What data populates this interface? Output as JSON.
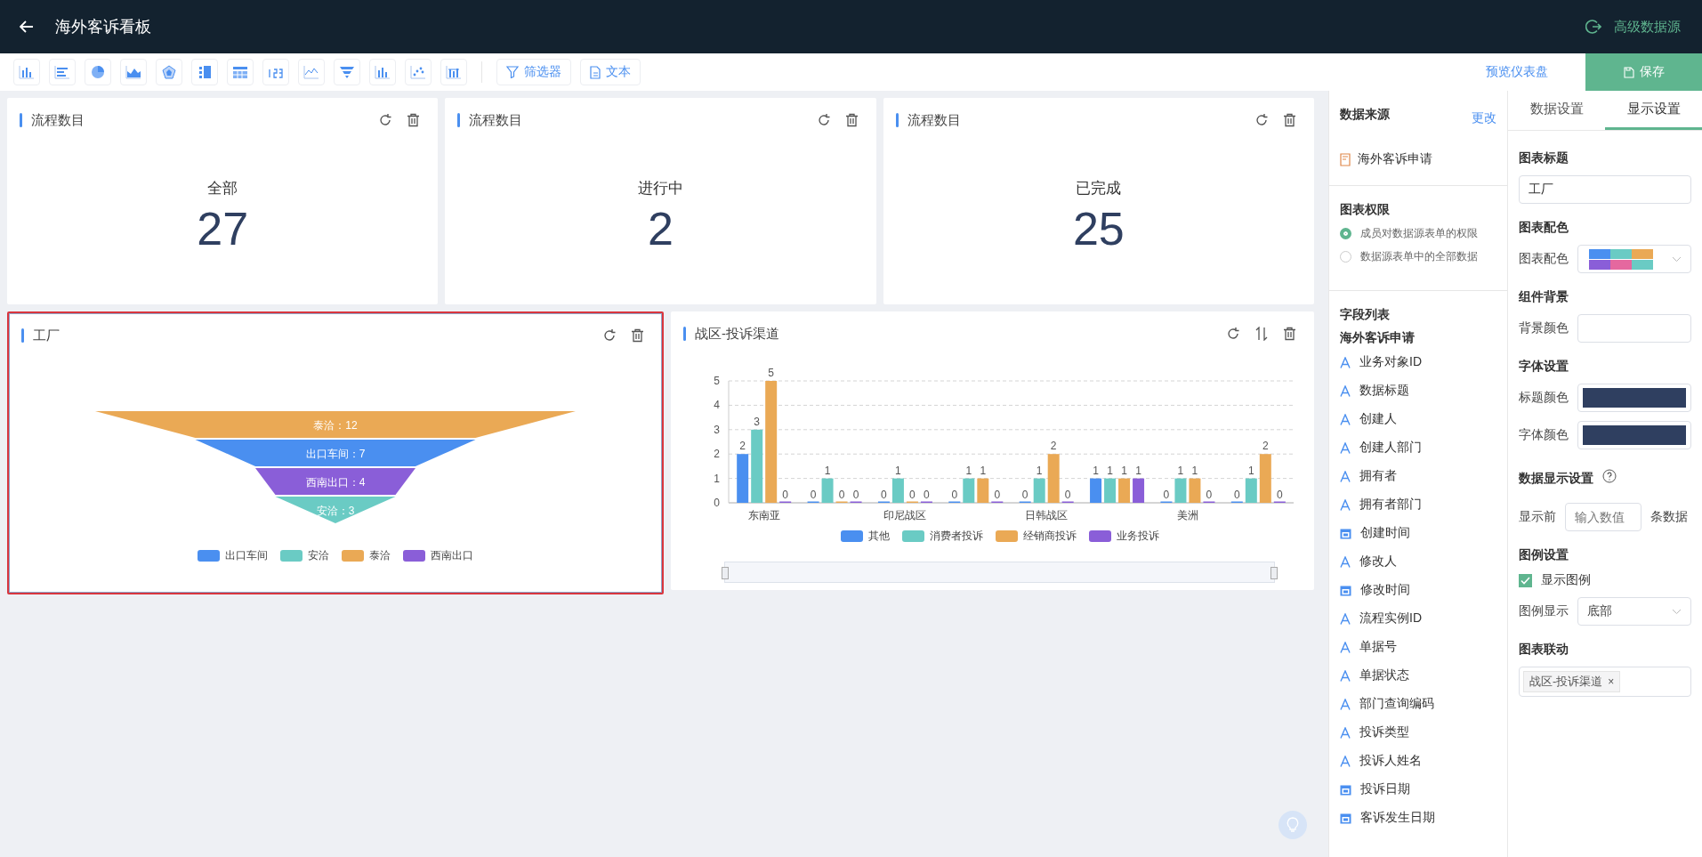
{
  "header": {
    "title": "海外客诉看板",
    "action": "高级数据源"
  },
  "toolbar": {
    "filter": "筛选器",
    "text": "文本",
    "preview": "预览仪表盘",
    "save": "保存"
  },
  "stats": [
    {
      "title": "流程数目",
      "label": "全部",
      "value": "27"
    },
    {
      "title": "流程数目",
      "label": "进行中",
      "value": "2"
    },
    {
      "title": "流程数目",
      "label": "已完成",
      "value": "25"
    }
  ],
  "funnel_card": {
    "title": "工厂",
    "selected": true,
    "separator": "：",
    "segments": [
      {
        "name": "泰洽",
        "value": "12",
        "color": "#eaa955"
      },
      {
        "name": "出口车间",
        "value": "7",
        "color": "#4a8ff0"
      },
      {
        "name": "西南出口",
        "value": "4",
        "color": "#8a5ed8"
      },
      {
        "name": "安洽",
        "value": "3",
        "color": "#6acbc4"
      }
    ],
    "legend": [
      {
        "label": "出口车间",
        "color": "#4a8ff0"
      },
      {
        "label": "安洽",
        "color": "#6acbc4"
      },
      {
        "label": "泰洽",
        "color": "#eaa955"
      },
      {
        "label": "西南出口",
        "color": "#8a5ed8"
      }
    ]
  },
  "bar_card": {
    "title": "战区-投诉渠道",
    "chart_data": {
      "type": "bar",
      "categories": [
        "东南亚",
        null,
        "印尼战区",
        null,
        "日韩战区",
        null,
        "美洲",
        null
      ],
      "ylim": [
        0,
        5
      ],
      "yticks": [
        0,
        1,
        2,
        3,
        4,
        5
      ],
      "data_labels": true,
      "grid": true,
      "legend": true,
      "series": [
        {
          "name": "其他",
          "color": "#4a8ff0",
          "values": [
            2,
            0,
            0,
            0,
            0,
            1,
            0,
            0
          ]
        },
        {
          "name": "消费者投诉",
          "color": "#6acbc4",
          "values": [
            3,
            1,
            1,
            1,
            1,
            1,
            1,
            1
          ]
        },
        {
          "name": "经销商投诉",
          "color": "#eaa955",
          "values": [
            5,
            0,
            0,
            1,
            2,
            1,
            1,
            2
          ]
        },
        {
          "name": "业务投诉",
          "color": "#8a5ed8",
          "values": [
            0,
            0,
            0,
            0,
            0,
            1,
            0,
            0
          ]
        }
      ]
    },
    "range_slider": {
      "level": 1
    }
  },
  "data_panel": {
    "source_heading": "数据来源",
    "change": "更改",
    "source": "海外客诉申请",
    "permission_heading": "图表权限",
    "permissions": [
      {
        "label": "成员对数据源表单的权限",
        "selected": true
      },
      {
        "label": "数据源表单中的全部数据",
        "selected": false
      }
    ],
    "fields_heading": "字段列表",
    "form_name": "海外客诉申请",
    "fields": [
      {
        "kind": "text",
        "label": "业务对象ID"
      },
      {
        "kind": "text",
        "label": "数据标题"
      },
      {
        "kind": "text",
        "label": "创建人"
      },
      {
        "kind": "text",
        "label": "创建人部门"
      },
      {
        "kind": "text",
        "label": "拥有者"
      },
      {
        "kind": "text",
        "label": "拥有者部门"
      },
      {
        "kind": "date",
        "label": "创建时间"
      },
      {
        "kind": "text",
        "label": "修改人"
      },
      {
        "kind": "date",
        "label": "修改时间"
      },
      {
        "kind": "text",
        "label": "流程实例ID"
      },
      {
        "kind": "text",
        "label": "单据号"
      },
      {
        "kind": "text",
        "label": "单据状态"
      },
      {
        "kind": "text",
        "label": "部门查询编码"
      },
      {
        "kind": "text",
        "label": "投诉类型"
      },
      {
        "kind": "text",
        "label": "投诉人姓名"
      },
      {
        "kind": "date",
        "label": "投诉日期"
      },
      {
        "kind": "date",
        "label": "客诉发生日期"
      }
    ]
  },
  "settings": {
    "tabs": [
      {
        "label": "数据设置",
        "selected": false
      },
      {
        "label": "显示设置",
        "selected": true
      }
    ],
    "chart_title_heading": "图表标题",
    "chart_title": "工厂",
    "palette_heading": "图表配色",
    "palette_label": "图表配色",
    "palette": [
      {
        "color": "#4a8ff0"
      },
      {
        "color": "#6acbc4"
      },
      {
        "color": "#eaa955"
      },
      {
        "color": "#8a5ed8"
      },
      {
        "color": "#e5689f"
      },
      {
        "color": "#6acbc4"
      }
    ],
    "background_heading": "组件背景",
    "background_label": "背景颜色",
    "font_heading": "字体设置",
    "title_color_label": "标题颜色",
    "font_color_label": "字体颜色",
    "display_heading": "数据显示设置",
    "show_before": "显示前",
    "count_placeholder": "输入数值",
    "rows_suffix": "条数据",
    "legend_heading": "图例设置",
    "show_legend": {
      "label": "显示图例",
      "checked": true
    },
    "legend_pos_label": "图例显示",
    "legend_pos": "底部",
    "linkage_heading": "图表联动",
    "linkage_tags": [
      "战区-投诉渠道"
    ],
    "close_mark": "×"
  }
}
